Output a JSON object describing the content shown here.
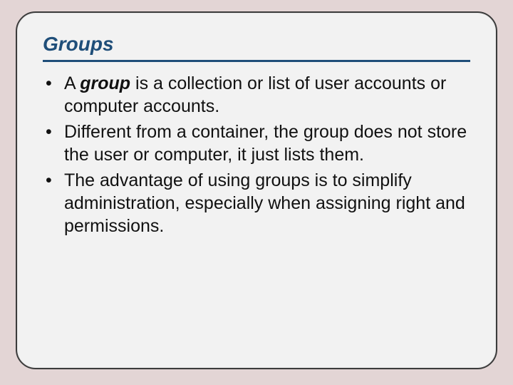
{
  "slide": {
    "title": "Groups",
    "bullets": [
      {
        "prefix": "A ",
        "emph": "group",
        "suffix": " is a collection or list of user accounts or computer accounts."
      },
      {
        "text": "Different from a container, the group does not store the user or computer, it just lists them."
      },
      {
        "text": "The advantage of using groups is to simplify administration, especially when assigning right and permissions."
      }
    ]
  }
}
